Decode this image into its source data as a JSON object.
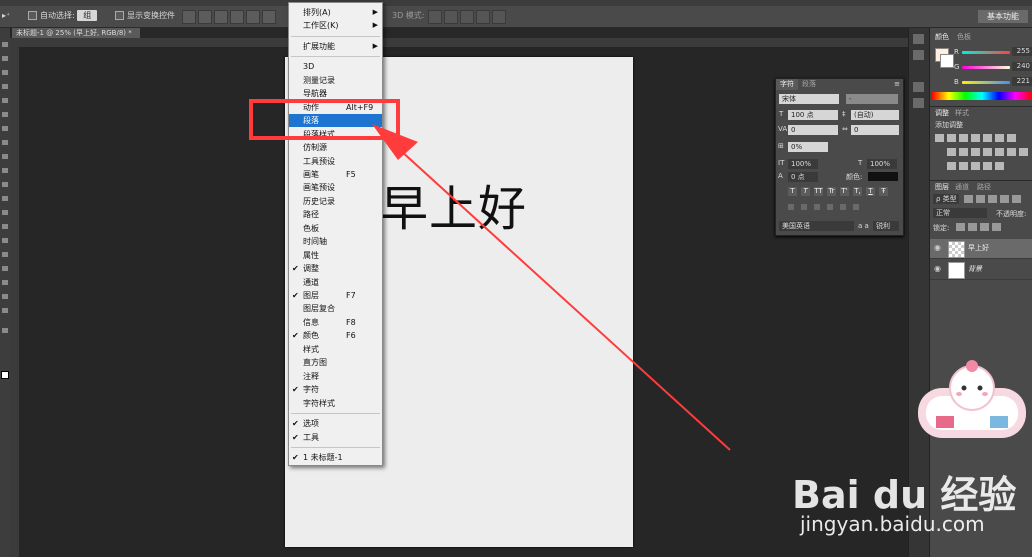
{
  "options_bar": {
    "auto_select_label": "自动选择:",
    "auto_select_value": "组",
    "show_transform_label": "显示变换控件",
    "mode_3d_label": "3D 模式:",
    "workspace_button": "基本功能"
  },
  "document_tab": {
    "label": "未标题-1 @ 25% (早上好, RGB/8) *"
  },
  "canvas": {
    "text": "早上好"
  },
  "window_menu": {
    "items": [
      {
        "label": "排列(A)",
        "shortcut": "",
        "checked": false,
        "submenu": true,
        "highlighted": false
      },
      {
        "label": "工作区(K)",
        "shortcut": "",
        "checked": false,
        "submenu": true,
        "highlighted": false
      },
      {
        "label": "扩展功能",
        "shortcut": "",
        "checked": false,
        "submenu": true,
        "highlighted": false
      },
      {
        "label": "3D",
        "shortcut": "",
        "checked": false,
        "submenu": false,
        "highlighted": false
      },
      {
        "label": "测量记录",
        "shortcut": "",
        "checked": false,
        "submenu": false,
        "highlighted": false
      },
      {
        "label": "导航器",
        "shortcut": "",
        "checked": false,
        "submenu": false,
        "highlighted": false
      },
      {
        "label": "动作",
        "shortcut": "Alt+F9",
        "checked": false,
        "submenu": false,
        "highlighted": false
      },
      {
        "label": "段落",
        "shortcut": "",
        "checked": false,
        "submenu": false,
        "highlighted": true
      },
      {
        "label": "段落样式",
        "shortcut": "",
        "checked": false,
        "submenu": false,
        "highlighted": false
      },
      {
        "label": "仿制源",
        "shortcut": "",
        "checked": false,
        "submenu": false,
        "highlighted": false
      },
      {
        "label": "工具预设",
        "shortcut": "",
        "checked": false,
        "submenu": false,
        "highlighted": false
      },
      {
        "label": "画笔",
        "shortcut": "F5",
        "checked": false,
        "submenu": false,
        "highlighted": false
      },
      {
        "label": "画笔预设",
        "shortcut": "",
        "checked": false,
        "submenu": false,
        "highlighted": false
      },
      {
        "label": "历史记录",
        "shortcut": "",
        "checked": false,
        "submenu": false,
        "highlighted": false
      },
      {
        "label": "路径",
        "shortcut": "",
        "checked": false,
        "submenu": false,
        "highlighted": false
      },
      {
        "label": "色板",
        "shortcut": "",
        "checked": false,
        "submenu": false,
        "highlighted": false
      },
      {
        "label": "时间轴",
        "shortcut": "",
        "checked": false,
        "submenu": false,
        "highlighted": false
      },
      {
        "label": "属性",
        "shortcut": "",
        "checked": false,
        "submenu": false,
        "highlighted": false
      },
      {
        "label": "调整",
        "shortcut": "",
        "checked": true,
        "submenu": false,
        "highlighted": false
      },
      {
        "label": "通道",
        "shortcut": "",
        "checked": false,
        "submenu": false,
        "highlighted": false
      },
      {
        "label": "图层",
        "shortcut": "F7",
        "checked": true,
        "submenu": false,
        "highlighted": false
      },
      {
        "label": "图层复合",
        "shortcut": "",
        "checked": false,
        "submenu": false,
        "highlighted": false
      },
      {
        "label": "信息",
        "shortcut": "F8",
        "checked": false,
        "submenu": false,
        "highlighted": false
      },
      {
        "label": "颜色",
        "shortcut": "F6",
        "checked": true,
        "submenu": false,
        "highlighted": false
      },
      {
        "label": "样式",
        "shortcut": "",
        "checked": false,
        "submenu": false,
        "highlighted": false
      },
      {
        "label": "直方图",
        "shortcut": "",
        "checked": false,
        "submenu": false,
        "highlighted": false
      },
      {
        "label": "注释",
        "shortcut": "",
        "checked": false,
        "submenu": false,
        "highlighted": false
      },
      {
        "label": "字符",
        "shortcut": "",
        "checked": true,
        "submenu": false,
        "highlighted": false
      },
      {
        "label": "字符样式",
        "shortcut": "",
        "checked": false,
        "submenu": false,
        "highlighted": false
      },
      {
        "label": "选项",
        "shortcut": "",
        "checked": true,
        "submenu": false,
        "highlighted": false
      },
      {
        "label": "工具",
        "shortcut": "",
        "checked": true,
        "submenu": false,
        "highlighted": false
      },
      {
        "label": "1 未标题-1",
        "shortcut": "",
        "checked": true,
        "submenu": false,
        "highlighted": false
      }
    ]
  },
  "character_panel": {
    "tabs": [
      "字符",
      "段落"
    ],
    "font_family": "宋体",
    "font_style": "-",
    "size": "100 点",
    "leading": "(自动)",
    "kerning": "0",
    "tracking": "0",
    "scale_label": "0%",
    "vertical_scale": "100%",
    "horizontal_scale": "100%",
    "baseline": "0 点",
    "color_label": "颜色:",
    "style_buttons": [
      "T",
      "T",
      "TT",
      "Tr",
      "T'",
      "T,",
      "T",
      "Ŧ"
    ],
    "language": "美国英语",
    "antialias": "锐利",
    "aa_prefix": "a a"
  },
  "color_panel": {
    "tabs": [
      "颜色",
      "色板"
    ],
    "channels": [
      {
        "label": "R",
        "value": "255"
      },
      {
        "label": "G",
        "value": "240"
      },
      {
        "label": "B",
        "value": "221"
      }
    ]
  },
  "adjustments_panel": {
    "tabs": [
      "调整",
      "样式"
    ],
    "heading": "添加调整"
  },
  "layers_panel": {
    "tabs": [
      "图层",
      "通道",
      "路径"
    ],
    "filter_kind": "ρ 类型",
    "blend_mode": "正常",
    "opacity_label": "不透明度:",
    "lock_label": "锁定:",
    "layers": [
      {
        "name": "早上好",
        "selected": true
      },
      {
        "name": "背景",
        "selected": false
      }
    ]
  },
  "watermark": {
    "logo": "Bai du 经验",
    "url": "jingyan.baidu.com"
  },
  "colors": {
    "menu_highlight": "#1e74d1",
    "annotation_red": "#ff3b3b",
    "slider_r": "#ff4040",
    "slider_g": "#d040d0",
    "slider_b": "#4090ff"
  }
}
